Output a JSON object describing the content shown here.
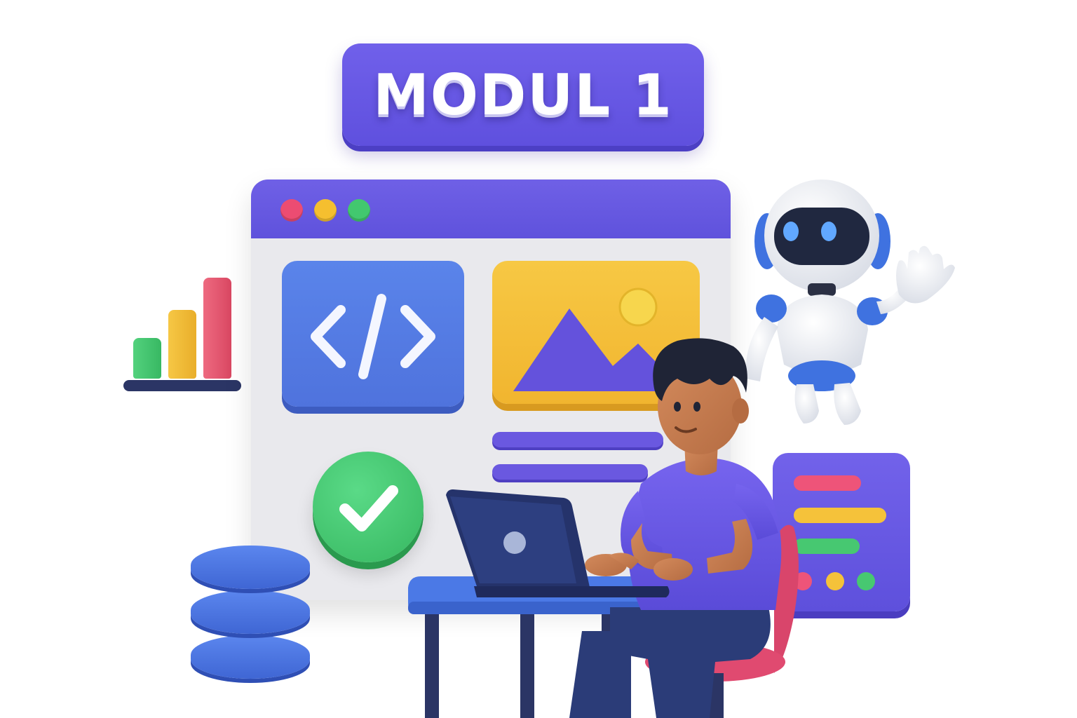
{
  "title": {
    "text": "MODUL 1"
  },
  "colors": {
    "brand_purple": "#6656e2",
    "code_blue": "#5a7fe6",
    "image_yellow": "#f4c13c",
    "success_green": "#45c76f",
    "accent_red": "#ec4c72",
    "navy": "#2b3565"
  },
  "illustration": {
    "browser_window": {
      "window_controls": [
        "red-dot",
        "yellow-dot",
        "green-dot"
      ],
      "cards": [
        {
          "icon": "code-brackets-icon"
        },
        {
          "icon": "image-mountain-sun-icon"
        },
        {
          "icon": "checkmark-icon"
        }
      ]
    },
    "bar_chart": {
      "bar_colors": [
        "green",
        "yellow",
        "red"
      ]
    },
    "side_panel": {
      "line_colors": [
        "red",
        "yellow",
        "green"
      ],
      "dot_colors": [
        "red",
        "yellow",
        "green"
      ]
    },
    "characters": [
      "person-at-laptop",
      "waving-robot"
    ],
    "objects": [
      "database-stack",
      "desk",
      "laptop",
      "chair"
    ]
  }
}
